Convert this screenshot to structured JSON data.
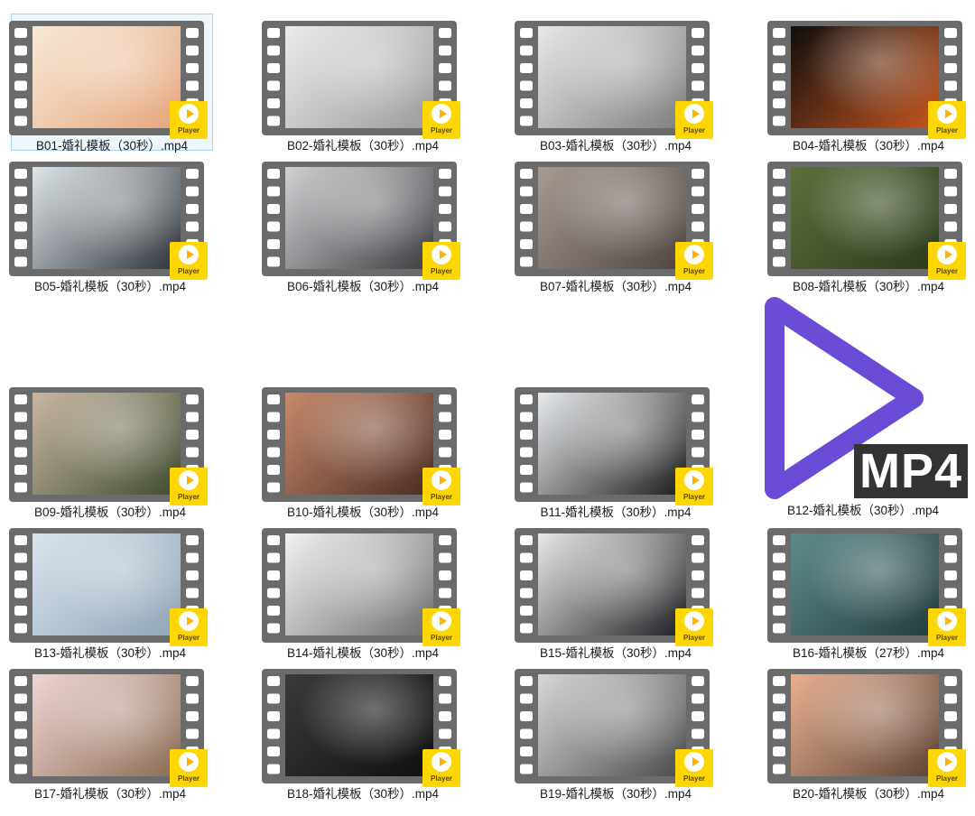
{
  "files": [
    {
      "name": "B01-婚礼模板（30秒）.mp4",
      "thumb": [
        "#f7e9d8",
        "#e6a57a"
      ],
      "selected": true
    },
    {
      "name": "B02-婚礼模板（30秒）.mp4",
      "thumb": [
        "#ececec",
        "#9a9a9a"
      ]
    },
    {
      "name": "B03-婚礼模板（30秒）.mp4",
      "thumb": [
        "#e8e8e8",
        "#7d7d7d"
      ]
    },
    {
      "name": "B04-婚礼模板（30秒）.mp4",
      "thumb": [
        "#0e0e0e",
        "#c8561e"
      ]
    },
    {
      "name": "B05-婚礼模板（30秒）.mp4",
      "thumb": [
        "#dfe6ea",
        "#2d3238"
      ]
    },
    {
      "name": "B06-婚礼模板（30秒）.mp4",
      "thumb": [
        "#cfd1d3",
        "#3b3d40"
      ]
    },
    {
      "name": "B07-婚礼模板（30秒）.mp4",
      "thumb": [
        "#a79b93",
        "#4f4540"
      ]
    },
    {
      "name": "B08-婚礼模板（30秒）.mp4",
      "thumb": [
        "#5c6f3b",
        "#2c3a1d"
      ]
    },
    {
      "name": "B09-婚礼模板（30秒）.mp4",
      "thumb": [
        "#c9b7a3",
        "#3f4b2f"
      ]
    },
    {
      "name": "B10-婚礼模板（30秒）.mp4",
      "thumb": [
        "#c88a6d",
        "#4a2b22"
      ]
    },
    {
      "name": "B11-婚礼模板（30秒）.mp4",
      "thumb": [
        "#e9ecef",
        "#1b1b1b"
      ]
    },
    {
      "name": "B13-婚礼模板（30秒）.mp4",
      "thumb": [
        "#d9e4ee",
        "#8fa4b6"
      ]
    },
    {
      "name": "B14-婚礼模板（30秒）.mp4",
      "thumb": [
        "#f2f2f2",
        "#6d6d6d"
      ]
    },
    {
      "name": "B15-婚礼模板（30秒）.mp4",
      "thumb": [
        "#e9e9ea",
        "#1e1e22"
      ]
    },
    {
      "name": "B16-婚礼模板（27秒）.mp4",
      "thumb": [
        "#5e8b8c",
        "#243b3d"
      ]
    },
    {
      "name": "B17-婚礼模板（30秒）.mp4",
      "thumb": [
        "#f0d6d4",
        "#8a6a52"
      ]
    },
    {
      "name": "B18-婚礼模板（30秒）.mp4",
      "thumb": [
        "#3a3a3a",
        "#0f0f0f"
      ]
    },
    {
      "name": "B19-婚礼模板（30秒）.mp4",
      "thumb": [
        "#d8d8d8",
        "#4a4a4a"
      ]
    },
    {
      "name": "B20-婚礼模板（30秒）.mp4",
      "thumb": [
        "#e8b091",
        "#5d4335"
      ]
    }
  ],
  "badge_label": "Player",
  "mp4_file": {
    "name": "B12-婚礼模板（30秒）.mp4",
    "badge_text": "MP4"
  },
  "colors": {
    "film": "#6b6b6b",
    "badge": "#ffd600",
    "mp4_accent": "#6a4bd6",
    "selection_border": "#a9d4f5"
  }
}
